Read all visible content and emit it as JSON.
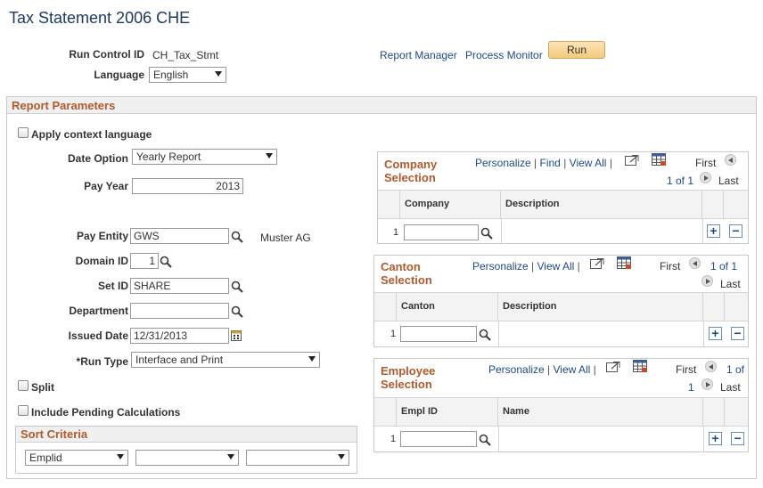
{
  "page": {
    "title": "Tax Statement 2006 CHE"
  },
  "header": {
    "run_control_label": "Run Control ID",
    "run_control_value": "CH_Tax_Stmt",
    "language_label": "Language",
    "language_value": "English",
    "report_manager": "Report Manager",
    "process_monitor": "Process Monitor",
    "run_button": "Run"
  },
  "report_parameters": {
    "title": "Report Parameters",
    "apply_context_language": "Apply context language",
    "date_option_label": "Date Option",
    "date_option_value": "Yearly Report",
    "pay_year_label": "Pay Year",
    "pay_year_value": "2013",
    "pay_entity_label": "Pay Entity",
    "pay_entity_value": "GWS",
    "pay_entity_desc": "Muster AG",
    "domain_id_label": "Domain ID",
    "domain_id_value": "1",
    "set_id_label": "Set ID",
    "set_id_value": "SHARE",
    "department_label": "Department",
    "department_value": "",
    "issued_date_label": "Issued Date",
    "issued_date_value": "12/31/2013",
    "run_type_label": "*Run Type",
    "run_type_value": "Interface and Print",
    "split_label": "Split",
    "include_pending_label": "Include Pending Calculations",
    "sort_criteria_title": "Sort Criteria",
    "sort_1": "Emplid",
    "sort_2": "",
    "sort_3": ""
  },
  "company_grid": {
    "title_line1": "Company",
    "title_line2": "Selection",
    "personalize": "Personalize",
    "find": "Find",
    "view_all": "View All",
    "first": "First",
    "pager": "1 of 1",
    "last": "Last",
    "col1": "Company",
    "col2": "Description",
    "row_num": "1"
  },
  "canton_grid": {
    "title_line1": "Canton",
    "title_line2": "Selection",
    "personalize": "Personalize",
    "view_all": "View All",
    "first": "First",
    "pager": "1 of 1",
    "last": "Last",
    "col1": "Canton",
    "col2": "Description",
    "row_num": "1"
  },
  "employee_grid": {
    "title_line1": "Employee",
    "title_line2": "Selection",
    "personalize": "Personalize",
    "view_all": "View All",
    "first": "First",
    "pager_a": "1 of",
    "pager_b": "1",
    "last": "Last",
    "col1": "Empl ID",
    "col2": "Name",
    "row_num": "1"
  },
  "icons": [
    "search-icon",
    "calendar-icon",
    "zoom-icon",
    "grid-icon",
    "add-row-icon",
    "delete-row-icon"
  ]
}
